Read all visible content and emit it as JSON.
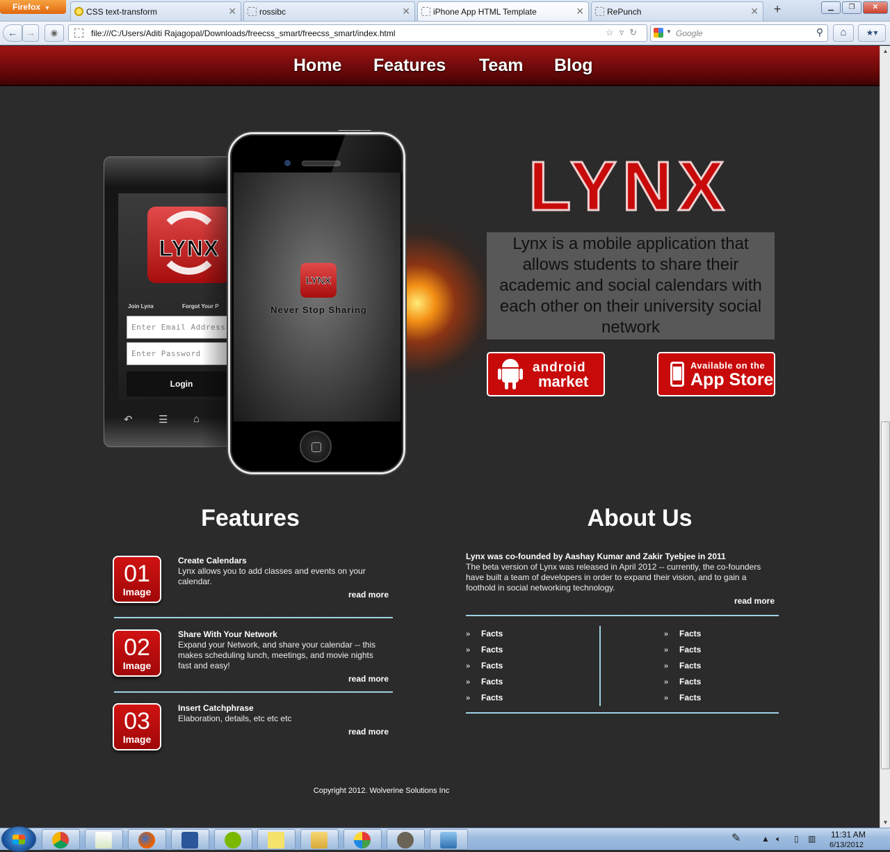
{
  "browser": {
    "menu_button": "Firefox",
    "tabs": [
      {
        "label": "CSS text-transform"
      },
      {
        "label": "rossibc"
      },
      {
        "label": "iPhone App HTML Template"
      },
      {
        "label": "RePunch"
      }
    ],
    "new_tab": "+",
    "url": "file:///C:/Users/Aditi Rajagopal/Downloads/freecss_smart/freecss_smart/index.html",
    "search_placeholder": "Google"
  },
  "site": {
    "nav": [
      "Home",
      "Features",
      "Team",
      "Blog"
    ],
    "hero": {
      "title": "LYNX",
      "description": "Lynx is a mobile application that allows students to share their academic and social calendars with each other on their university social network",
      "android_badge_line1": "android",
      "android_badge_line2": "market",
      "appstore_line1": "Available on the",
      "appstore_line2": "App Store"
    },
    "phones": {
      "android_logo_text": "LYNX",
      "join_label": "Join Lynx",
      "forgot_label": "Forgot Your P",
      "email_placeholder": "Enter Email Address",
      "password_placeholder": "Enter Password",
      "login_label": "Login",
      "iphone_logo_text": "LYNX",
      "iphone_tagline": "Never Stop Sharing"
    },
    "features": {
      "heading": "Features",
      "items": [
        {
          "num": "01",
          "badge_label": "Image",
          "title": "Create Calendars",
          "text": "Lynx allows you to add classes and events on your calendar.",
          "read_more": "read more"
        },
        {
          "num": "02",
          "badge_label": "Image",
          "title": "Share With Your Network",
          "text": "Expand your Network, and share your calendar -- this makes scheduling lunch, meetings, and movie nights fast and easy!",
          "read_more": "read more"
        },
        {
          "num": "03",
          "badge_label": "Image",
          "title": "Insert Catchphrase",
          "text": "Elaboration, details, etc etc etc",
          "read_more": "read more"
        }
      ]
    },
    "about": {
      "heading": "About Us",
      "lead": "Lynx was co-founded by Aashay Kumar and Zakir Tyebjee in 2011",
      "text": "The beta version of Lynx was released in April 2012 -- currently, the co-founders have built a team of developers in order to expand their vision, and to gain a foothold in social networking technology.",
      "read_more": "read more",
      "facts_left": [
        "Facts",
        "Facts",
        "Facts",
        "Facts",
        "Facts"
      ],
      "facts_right": [
        "Facts",
        "Facts",
        "Facts",
        "Facts",
        "Facts"
      ]
    },
    "footer": "Copyright 2012. Wolverine Solutions Inc"
  },
  "taskbar": {
    "time": "11:31 AM",
    "date": "6/13/2012"
  },
  "colors": {
    "brand_red": "#c80a0a",
    "nav_red": "#8c0c0c",
    "divider_blue": "#9fd2e4",
    "page_bg": "#2a2a2a"
  }
}
